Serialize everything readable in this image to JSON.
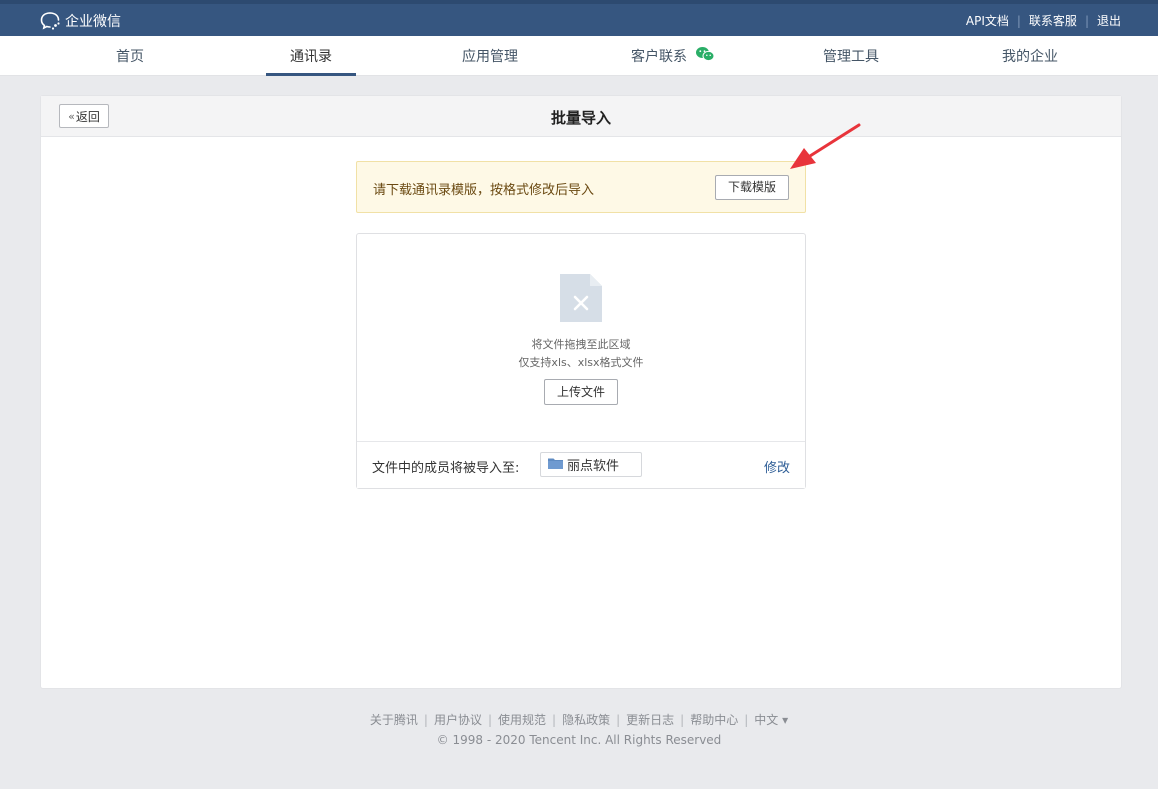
{
  "header": {
    "logo_text": "企业微信",
    "links": [
      "API文档",
      "联系客服",
      "退出"
    ]
  },
  "nav": {
    "items": [
      {
        "label": "首页"
      },
      {
        "label": "通讯录"
      },
      {
        "label": "应用管理"
      },
      {
        "label": "客户联系"
      },
      {
        "label": "管理工具"
      },
      {
        "label": "我的企业"
      }
    ],
    "active_index": 1
  },
  "page": {
    "back_label": "返回",
    "title": "批量导入"
  },
  "notice": {
    "text": "请下载通讯录模版，按格式修改后导入",
    "button_label": "下载模版"
  },
  "upload": {
    "drop_hint": "将文件拖拽至此区域",
    "format_hint": "仅支持xls、xlsx格式文件",
    "button_label": "上传文件",
    "target_label": "文件中的成员将被导入至:",
    "department": "丽点软件",
    "edit_label": "修改"
  },
  "footer": {
    "links": [
      "关于腾讯",
      "用户协议",
      "使用规范",
      "隐私政策",
      "更新日志",
      "帮助中心",
      "中文 ▾"
    ],
    "copyright": "© 1998 - 2020 Tencent Inc. All Rights Reserved"
  },
  "colors": {
    "header_bg": "#365680",
    "accent": "#365680",
    "notice_bg": "#fef9e6",
    "link": "#2d5d96",
    "wechat_green": "#2aae67",
    "annotation_red": "#e8343b"
  },
  "icons": {
    "logo": "chat-bubble-icon",
    "back": "double-chevron-left-icon",
    "customer": "wechat-icon",
    "file": "file-x-icon",
    "folder": "folder-icon",
    "annotation": "red-arrow-icon"
  }
}
